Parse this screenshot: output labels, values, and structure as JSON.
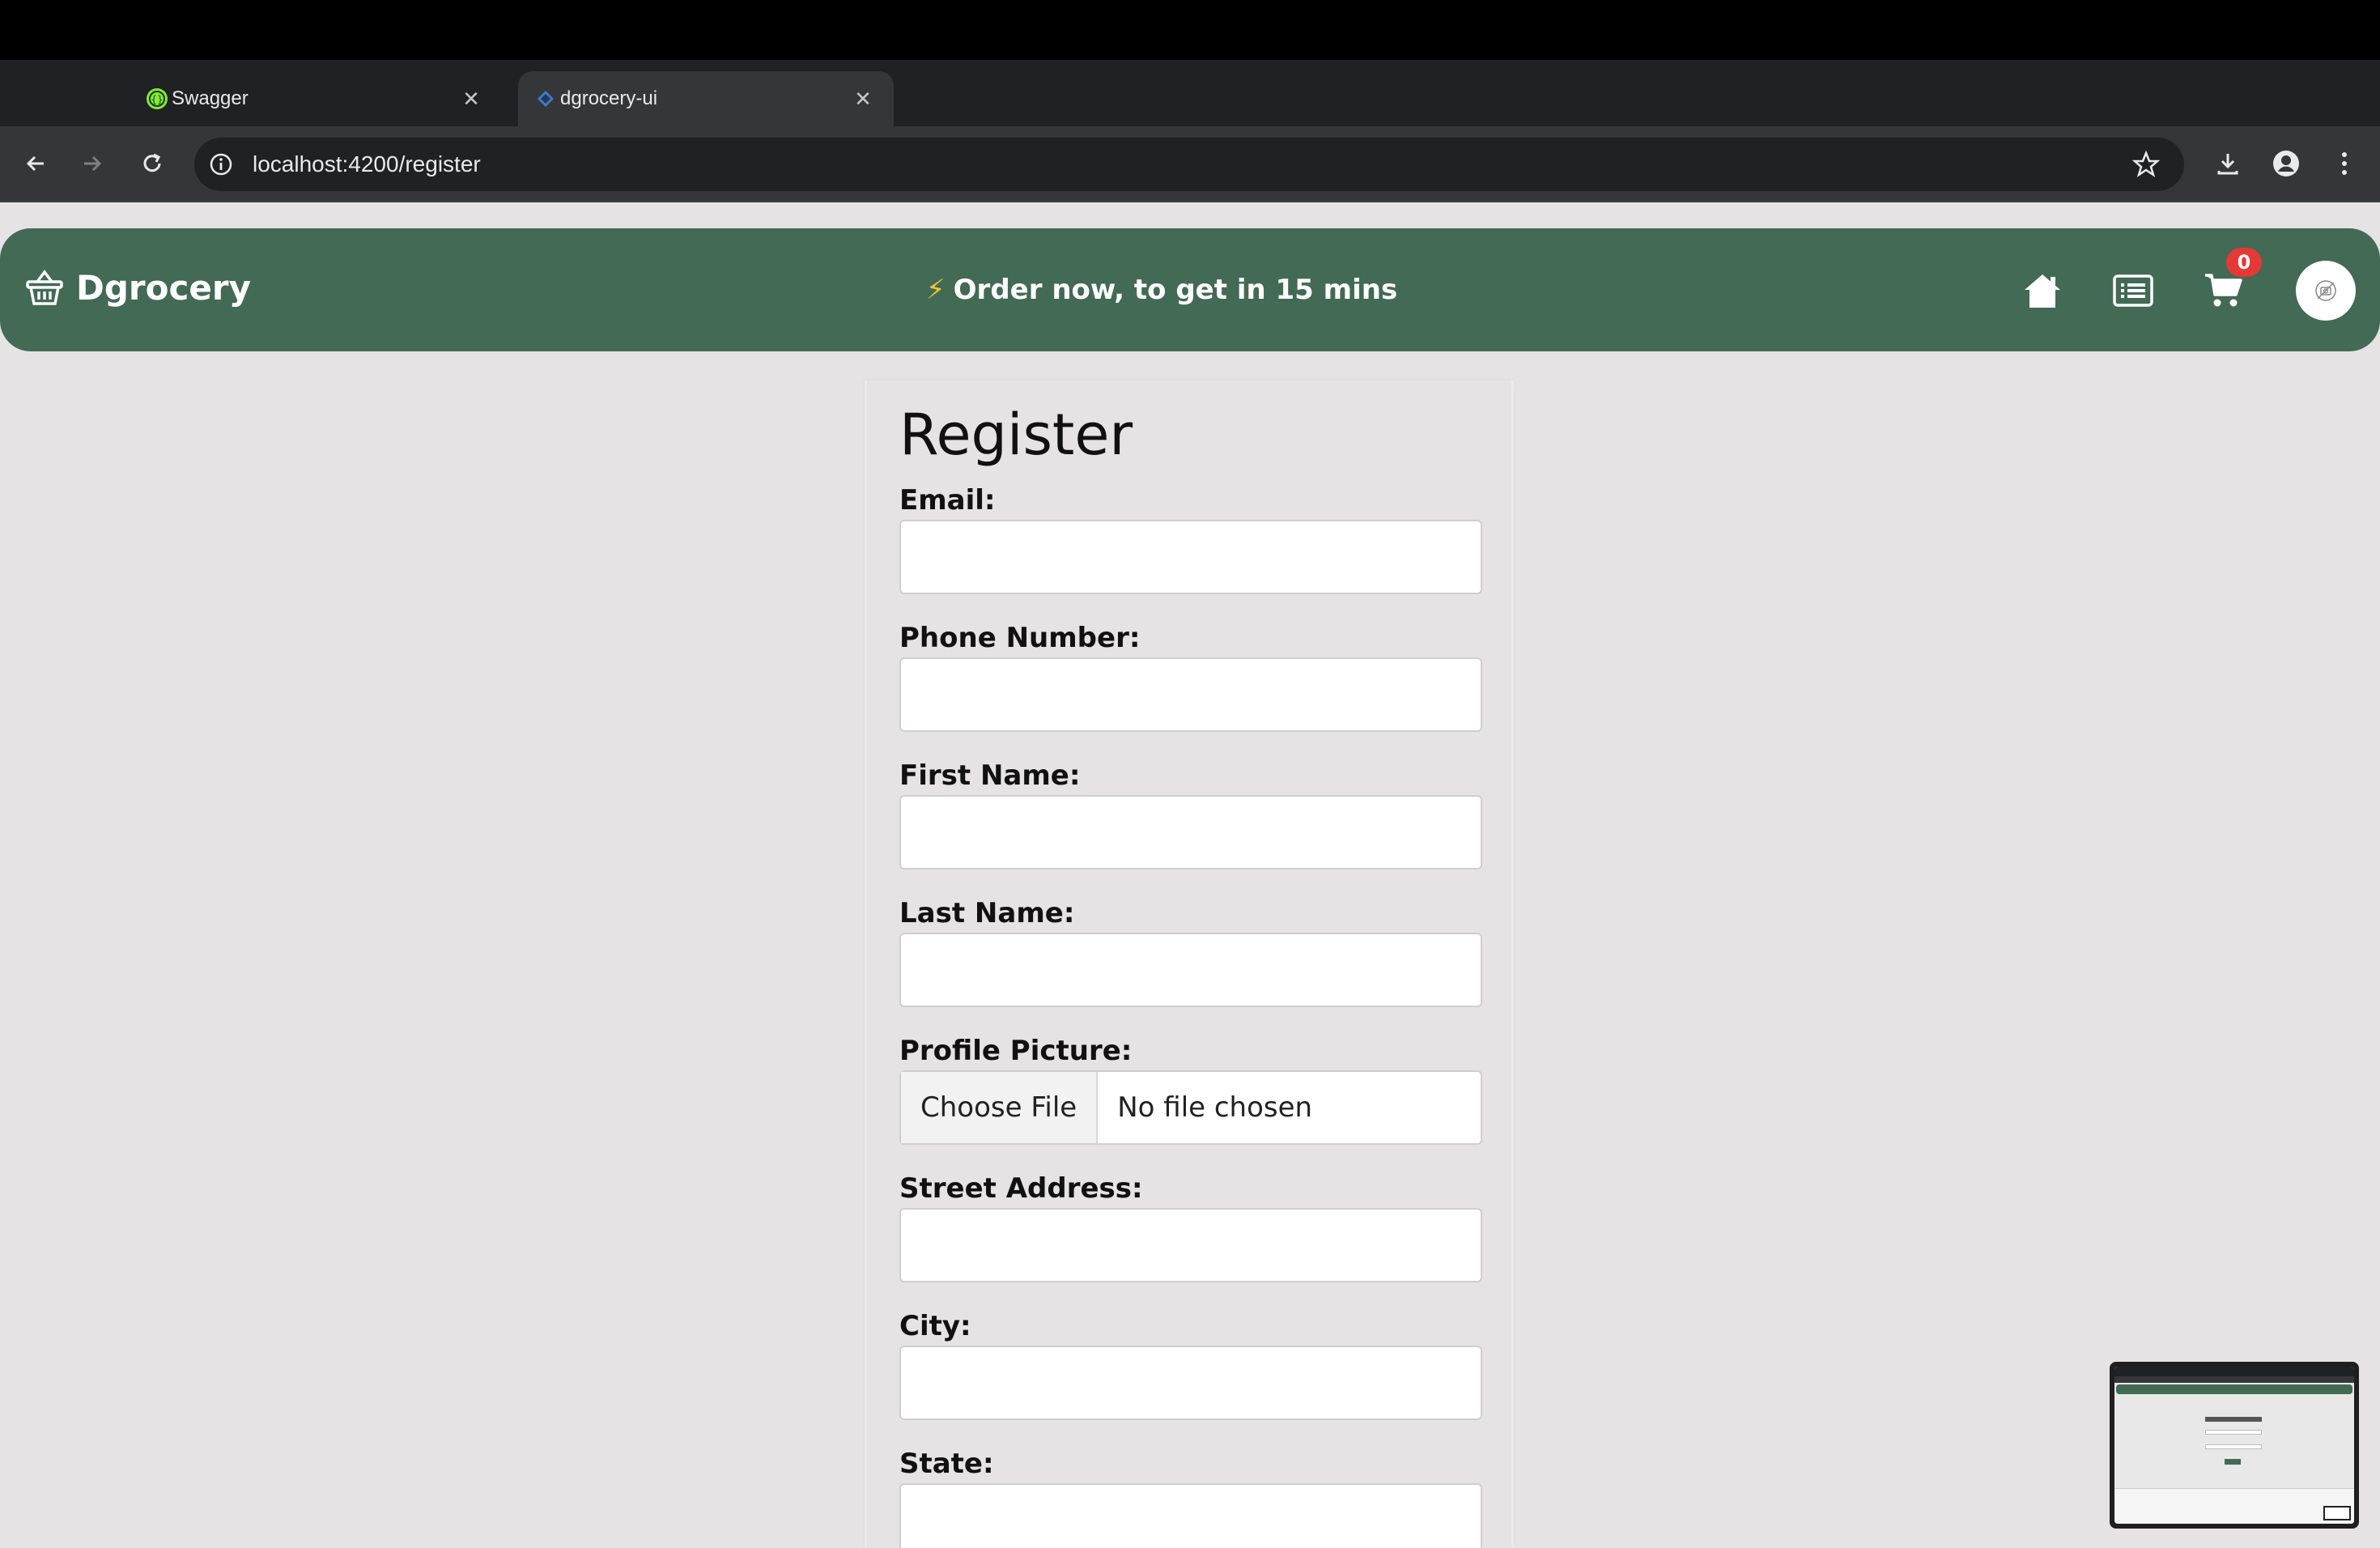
{
  "browser": {
    "tabs": [
      {
        "title": "Swagger",
        "active": false
      },
      {
        "title": "dgrocery-ui",
        "active": true
      }
    ],
    "url": "localhost:4200/register"
  },
  "header": {
    "brand": "Dgrocery",
    "promo_icon": "⚡",
    "promo_text": "Order now, to get in 15 mins",
    "cart_count": "0",
    "icons": [
      "home-icon",
      "orders-list-icon",
      "cart-icon",
      "profile-avatar"
    ]
  },
  "register": {
    "title": "Register",
    "fields": {
      "email": {
        "label": "Email:",
        "value": ""
      },
      "phone": {
        "label": "Phone Number:",
        "value": ""
      },
      "first_name": {
        "label": "First Name:",
        "value": ""
      },
      "last_name": {
        "label": "Last Name:",
        "value": ""
      },
      "profile_picture": {
        "label": "Profile Picture:",
        "button": "Choose File",
        "status": "No file chosen"
      },
      "street": {
        "label": "Street Address:",
        "value": ""
      },
      "city": {
        "label": "City:",
        "value": ""
      },
      "state": {
        "label": "State:",
        "value": ""
      }
    }
  },
  "colors": {
    "header_bg": "#426a55",
    "page_bg": "#e5e3e4",
    "badge": "#e53935",
    "bolt": "#f3c53b"
  }
}
